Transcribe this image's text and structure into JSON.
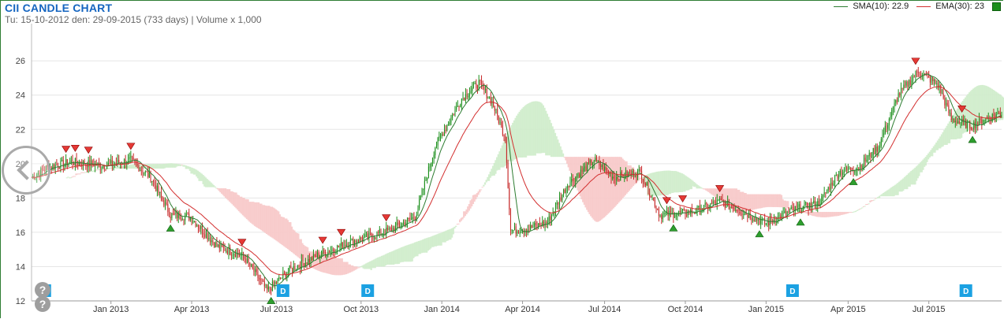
{
  "header": {
    "title": "CII CANDLE CHART",
    "subtitle": "Tu: 15-10-2012 den: 29-09-2015 (733 days) | Volume x 1,000"
  },
  "legend": {
    "sma_label": "SMA(10): 22.9",
    "ema_label": "EMA(30): 23",
    "sma_color": "#2e7d32",
    "ema_color": "#d32f2f",
    "candle_color": "#1b8f1b"
  },
  "colors": {
    "up": "#1b8f1b",
    "down": "#c62828",
    "cloud_bull": "#cfeccb",
    "cloud_bear": "#f7c9c9",
    "marker_up": "#2e9e2e",
    "marker_down": "#e53935",
    "dividend_badge": "#1ba1e2"
  },
  "chart_data": {
    "type": "candlestick",
    "title": "CII CANDLE CHART",
    "ylim": [
      12,
      27.8
    ],
    "yticks": [
      12,
      14,
      16,
      18,
      20,
      22,
      24,
      26
    ],
    "xlabels": [
      "Jan 2013",
      "Apr 2013",
      "Jul 2013",
      "Oct 2013",
      "Jan 2014",
      "Apr 2014",
      "Jul 2014",
      "Oct 2014",
      "Jan 2015",
      "Apr 2015",
      "Jul 2015"
    ],
    "x_anchor_days": [
      0,
      78,
      107,
      180,
      210,
      260,
      280,
      310,
      340,
      370,
      388,
      430,
      470,
      515,
      560,
      595,
      645,
      680,
      715,
      733
    ],
    "price_anchors": [
      19.2,
      19.3,
      19.6,
      19.8,
      19.0,
      17.3,
      16.5,
      15.6,
      14.5,
      13.5,
      15.0,
      15.7,
      16.8,
      24.5,
      25.6,
      25.5,
      23.2,
      16.0,
      19.8,
      19.2
    ],
    "price_anchors_full": [
      [
        0,
        19.2
      ],
      [
        12,
        19.8
      ],
      [
        30,
        20.1
      ],
      [
        55,
        19.9
      ],
      [
        75,
        20.2
      ],
      [
        90,
        19.2
      ],
      [
        105,
        17.0
      ],
      [
        120,
        16.9
      ],
      [
        140,
        15.2
      ],
      [
        160,
        14.6
      ],
      [
        178,
        12.6
      ],
      [
        195,
        13.8
      ],
      [
        215,
        14.6
      ],
      [
        240,
        15.4
      ],
      [
        270,
        16.1
      ],
      [
        290,
        16.9
      ],
      [
        305,
        21.0
      ],
      [
        325,
        23.8
      ],
      [
        338,
        24.7
      ],
      [
        348,
        23.6
      ],
      [
        358,
        21.5
      ],
      [
        362,
        16.1
      ],
      [
        375,
        16.2
      ],
      [
        390,
        16.6
      ],
      [
        405,
        18.8
      ],
      [
        425,
        20.2
      ],
      [
        440,
        19.2
      ],
      [
        460,
        19.5
      ],
      [
        475,
        17.0
      ],
      [
        500,
        17.2
      ],
      [
        520,
        17.8
      ],
      [
        540,
        17.1
      ],
      [
        555,
        16.5
      ],
      [
        575,
        17.3
      ],
      [
        595,
        17.7
      ],
      [
        610,
        19.5
      ],
      [
        625,
        19.8
      ],
      [
        640,
        21.0
      ],
      [
        655,
        24.0
      ],
      [
        670,
        25.4
      ],
      [
        685,
        24.6
      ],
      [
        695,
        22.6
      ],
      [
        710,
        22.2
      ],
      [
        733,
        23.0
      ]
    ],
    "dividend_markers_days": [
      10,
      190,
      254,
      575,
      706
    ],
    "last_values": {
      "sma10": 22.9,
      "ema30": 23
    }
  }
}
